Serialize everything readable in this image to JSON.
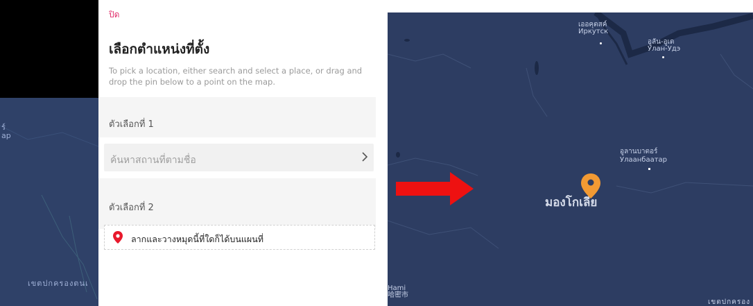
{
  "panel": {
    "close_label": "ปิด",
    "title": "เลือกตำแหน่งที่ตั้ง",
    "description": "To pick a location, either search and select a place, or drag and drop the pin below to a point on the map.",
    "option1_label": "ตัวเลือกที่ 1",
    "search_placeholder": "ค้นหาสถานที่ตามชื่อ",
    "option2_label": "ตัวเลือกที่ 2",
    "drag_pin_label": "ลากและวางหมุดนี้ที่ใดก็ได้บนแผนที่"
  },
  "left_map": {
    "fragment_top": "ร์\nap",
    "fragment_bottom": "เขตปกครองตนเ"
  },
  "right_map": {
    "irkutsk_th": "เออคุตสค์",
    "irkutsk_ru": "Иркутск",
    "ulanude_th": "อูลัน-อูเด",
    "ulanude_ru": "Улан-Удэ",
    "ulaanbaatar_th": "อูลานบาตอร์",
    "ulaanbaatar_ru": "Улаанбаатар",
    "country": "มองโกเลีย",
    "hami": "Hami\n哈密市",
    "bottom_right": "เขตปกครอง"
  },
  "colors": {
    "accent_pink": "#e1306c",
    "pin_red": "#e8192c",
    "map_pin_orange": "#f29a33",
    "arrow_red": "#ee1111",
    "map_bg": "#2d3d62"
  },
  "icons": {
    "search_chevron": "chevron-right-icon",
    "drag_pin": "map-pin-icon",
    "map_marker": "map-marker-icon"
  }
}
